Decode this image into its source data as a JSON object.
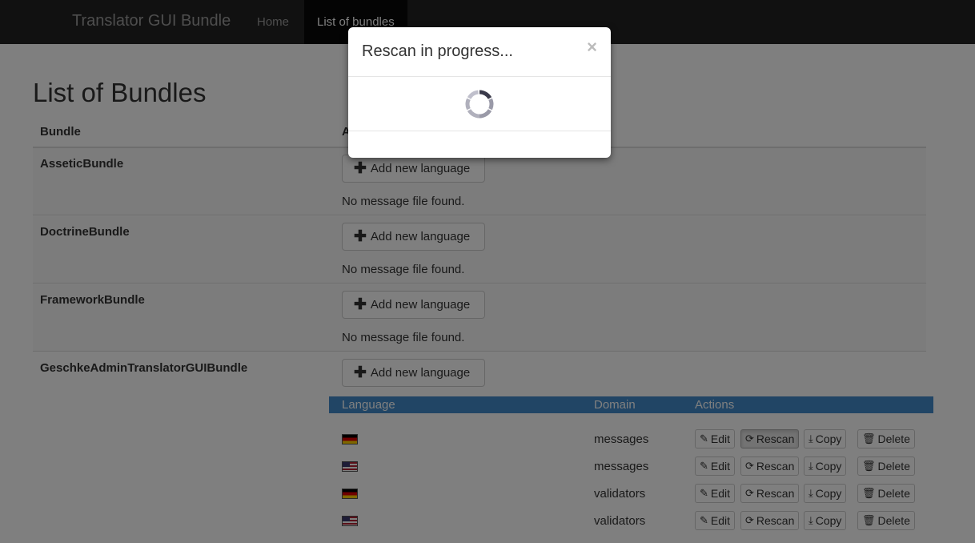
{
  "navbar": {
    "brand": "Translator GUI Bundle",
    "items": [
      {
        "label": "Home"
      },
      {
        "label": "List of bundles"
      }
    ]
  },
  "page": {
    "title": "List of Bundles"
  },
  "table": {
    "headers": [
      "Bundle",
      "A"
    ],
    "add_label": "Add new language",
    "no_message": "No message file found.",
    "bundles": [
      {
        "name": "AsseticBundle"
      },
      {
        "name": "DoctrineBundle"
      },
      {
        "name": "FrameworkBundle"
      },
      {
        "name": "GeschkeAdminTranslatorGUIBundle"
      }
    ]
  },
  "files": {
    "headers": [
      "Language",
      "Domain",
      "Actions"
    ],
    "rows": [
      {
        "flag": "flag-de-icon",
        "domain": "messages"
      },
      {
        "flag": "flag-us-icon",
        "domain": "messages"
      },
      {
        "flag": "flag-de-icon",
        "domain": "validators"
      },
      {
        "flag": "flag-us-icon",
        "domain": "validators"
      }
    ],
    "actions": [
      "Edit",
      "Rescan",
      "Copy",
      "Delete"
    ]
  },
  "modal": {
    "title": "Rescan in progress...",
    "close": "×"
  },
  "colors": {
    "navbar": "#222222",
    "accent": "#428bca",
    "backdrop": "rgba(0,0,0,0.5)"
  }
}
